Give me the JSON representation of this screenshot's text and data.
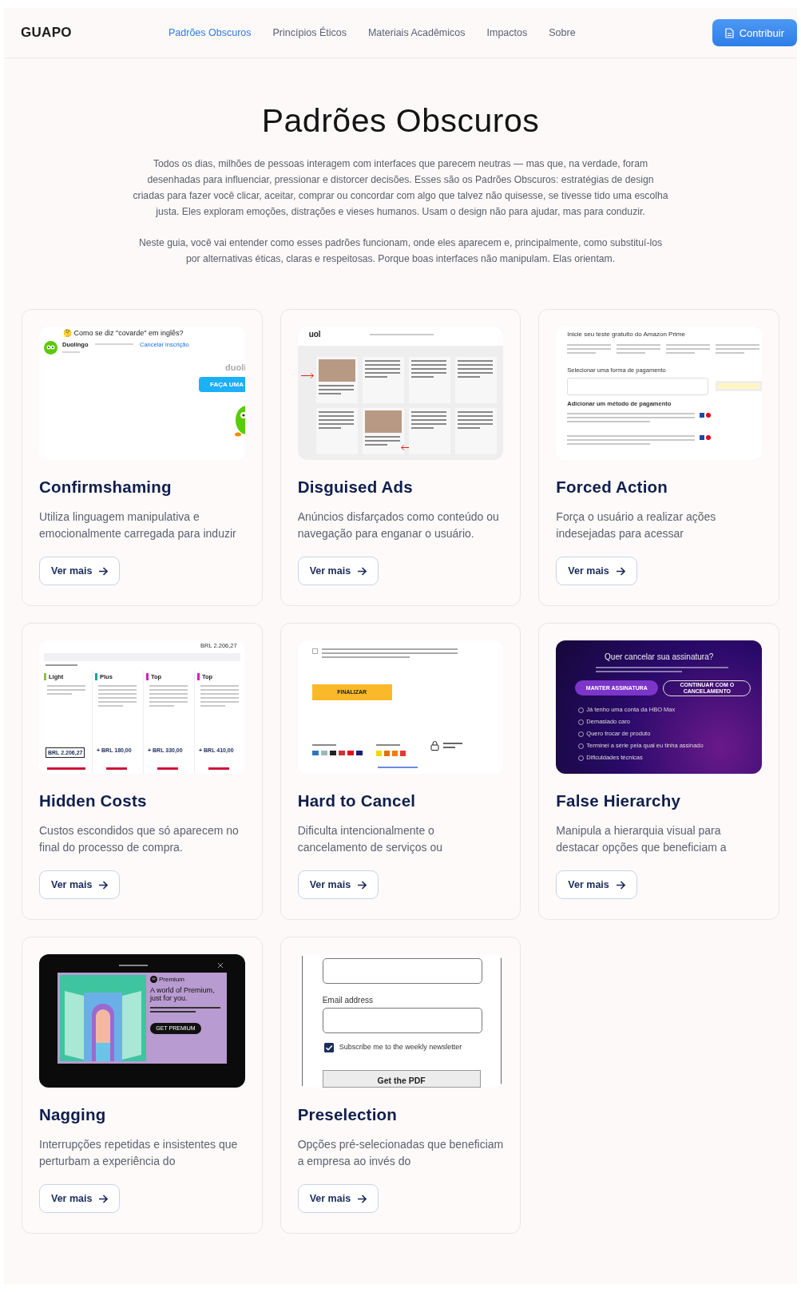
{
  "nav": {
    "logo": "GUAPO",
    "links": [
      {
        "label": "Padrões Obscuros",
        "selected": true
      },
      {
        "label": "Princípios Éticos",
        "selected": false
      },
      {
        "label": "Materiais Acadêmicos",
        "selected": false
      },
      {
        "label": "Impactos",
        "selected": false
      },
      {
        "label": "Sobre",
        "selected": false
      }
    ],
    "cta": "Contribuir"
  },
  "hero": {
    "title": "Padrões Obscuros",
    "paragraphs": [
      "Todos os dias, milhões de pessoas interagem com interfaces que parecem neutras — mas que, na verdade, foram desenhadas para influenciar, pressionar e distorcer decisões. Esses são os Padrões Obscuros: estratégias de design criadas para fazer você clicar, aceitar, comprar ou concordar com algo que talvez não quisesse, se tivesse tido uma escolha justa. Eles exploram emoções, distrações e vieses humanos. Usam o design não para ajudar, mas para conduzir.",
      "Neste guia, você vai entender como esses padrões funcionam, onde eles aparecem e, principalmente, como substituí-los por alternativas éticas, claras e respeitosas. Porque boas interfaces não manipulam. Elas orientam."
    ]
  },
  "cards": [
    {
      "title": "Confirmshaming",
      "description": "Utiliza linguagem manipulativa e emocionalmente carregada para induzir",
      "button": "Ver mais",
      "preview": {
        "kind": "email",
        "subject": "🤔 Como se diz \"covarde\" em inglês?",
        "sender": "Duolingo",
        "link": "Cancelar inscrição",
        "brand": "duoli",
        "cta": "FAÇA UMA"
      }
    },
    {
      "title": "Disguised Ads",
      "description": "Anúncios disfarçados como conteúdo ou navegação para enganar o usuário.",
      "button": "Ver mais",
      "preview": {
        "kind": "news",
        "logo": "uol",
        "items": [
          {
            "photo": true
          },
          {
            "photo": false
          },
          {
            "photo": false
          },
          {
            "photo": false
          },
          {
            "photo": false
          },
          {
            "photo": true
          },
          {
            "photo": false
          },
          {
            "photo": false
          }
        ]
      }
    },
    {
      "title": "Forced Action",
      "description": "Força o usuário a realizar ações indesejadas para acessar",
      "button": "Ver mais",
      "preview": {
        "kind": "payment",
        "heading": "Inicie seu teste gratuito do Amazon Prime",
        "select": "Selecionar uma forma de pagamento",
        "add": "Adicionar um método de pagamento"
      }
    },
    {
      "title": "Hidden Costs",
      "description": "Custos escondidos que só aparecem no final do processo de compra.",
      "button": "Ver mais",
      "preview": {
        "kind": "fares",
        "total": "BRL 2.206,27",
        "fares": [
          {
            "name": "Light",
            "color": "#8bc34a",
            "price": "BRL 2.206,27"
          },
          {
            "name": "Plus",
            "color": "#1aa3a3",
            "price": "+ BRL 180,00"
          },
          {
            "name": "Top",
            "color": "#d01fbd",
            "price": "+ BRL 330,00"
          },
          {
            "name": "Top",
            "color": "#d01fbd",
            "price": "+ BRL 410,00"
          }
        ]
      }
    },
    {
      "title": "Hard to Cancel",
      "description": "Dificulta intencionalmente o cancelamento de serviços ou",
      "button": "Ver mais",
      "preview": {
        "kind": "checkout",
        "checked": false,
        "submit": "FINALIZAR"
      }
    },
    {
      "title": "False Hierarchy",
      "description": "Manipula a hierarquia visual para destacar opções que beneficiam a",
      "button": "Ver mais",
      "preview": {
        "kind": "cancel",
        "heading": "Quer cancelar sua assinatura?",
        "primary": "MANTER ASSINATURA",
        "secondary": "CONTINUAR COM O CANCELAMENTO",
        "options": [
          {
            "label": "Já tenho uma conta da HBO Max",
            "selected": false
          },
          {
            "label": "Demasiado caro",
            "selected": false
          },
          {
            "label": "Quero trocar de produto",
            "selected": false
          },
          {
            "label": "Terminei a série pela qual eu tinha assinado",
            "selected": false
          },
          {
            "label": "Dificuldades técnicas",
            "selected": false
          }
        ]
      }
    },
    {
      "title": "Nagging",
      "description": "Interrupções repetidas e insistentes que perturbam a experiência do",
      "button": "Ver mais",
      "preview": {
        "kind": "modal",
        "brand": "Premium",
        "heading": "A world of Premium, just for you.",
        "cta": "GET PREMIUM"
      }
    },
    {
      "title": "Preselection",
      "description": "Opções pré-selecionadas que beneficiam a empresa ao invés do",
      "button": "Ver mais",
      "preview": {
        "kind": "form",
        "field": "Email address",
        "checkbox": "Subscribe me to the weekly newsletter",
        "checked": true,
        "submit": "Get the PDF"
      }
    }
  ]
}
